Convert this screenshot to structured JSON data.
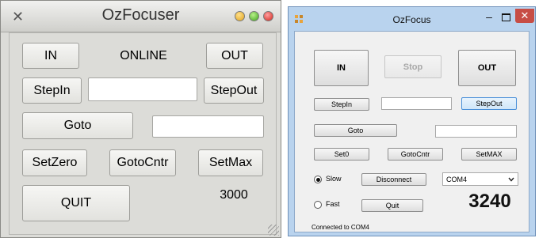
{
  "left_window": {
    "title": "OzFocuser",
    "status": "ONLINE",
    "position": "3000",
    "buttons": {
      "in": "IN",
      "out": "OUT",
      "step_in": "StepIn",
      "step_out": "StepOut",
      "goto": "Goto",
      "set_zero": "SetZero",
      "goto_center": "GotoCntr",
      "set_max": "SetMax",
      "quit": "QUIT"
    },
    "step_value": "",
    "goto_value": ""
  },
  "right_window": {
    "title": "OzFocus",
    "controls": {
      "minimize": "–",
      "close": "✕"
    },
    "buttons": {
      "in": "IN",
      "stop": "Stop",
      "out": "OUT",
      "step_in": "StepIn",
      "step_out": "StepOut",
      "goto": "Goto",
      "set_zero": "Set0",
      "goto_center": "GotoCntr",
      "set_max": "SetMAX",
      "disconnect": "Disconnect",
      "quit": "Quit"
    },
    "speed": {
      "slow": "Slow",
      "fast": "Fast",
      "selected": "slow"
    },
    "port": "COM4",
    "position": "3240",
    "status": "Connected to COM4",
    "step_value": "",
    "goto_value": ""
  }
}
